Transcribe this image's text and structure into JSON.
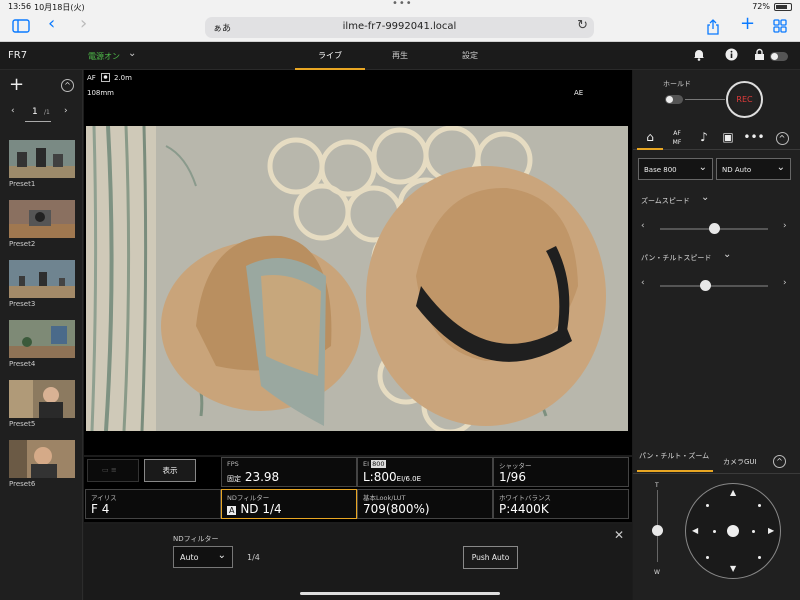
{
  "status": {
    "time": "13:56",
    "date": "10月18日(火)",
    "battery": "72%"
  },
  "browser": {
    "aa": "ぁあ",
    "url": "ilme-fr7-9992041.local"
  },
  "header": {
    "model": "FR7",
    "power": "電源オン",
    "tabs": [
      {
        "label": "ライブ",
        "active": true
      },
      {
        "label": "再生",
        "active": false
      },
      {
        "label": "設定",
        "active": false
      }
    ]
  },
  "presets": {
    "page": "1",
    "total": "/1",
    "items": [
      {
        "label": "Preset1"
      },
      {
        "label": "Preset2"
      },
      {
        "label": "Preset3"
      },
      {
        "label": "Preset4"
      },
      {
        "label": "Preset5"
      },
      {
        "label": "Preset6"
      }
    ]
  },
  "viewer": {
    "af": "AF",
    "distance": "2.0m",
    "focal": "108mm",
    "ae": "AE"
  },
  "info": {
    "display_button": "表示",
    "fps_key": "FPS",
    "fps_prefix": "固定",
    "fps_value": "23.98",
    "ei_key": "EI",
    "ei_badge": "800",
    "ei_value": "L:800",
    "ei_suffix": "EI/6.0E",
    "shutter_key": "シャッター",
    "shutter_value": "1/96",
    "iris_key": "アイリス",
    "iris_value": "F 4",
    "nd_key": "NDフィルター",
    "nd_badge": "A",
    "nd_value": "ND 1/4",
    "lut_key": "基本Look/LUT",
    "lut_value": "709(800%)",
    "wb_key": "ホワイトバランス",
    "wb_value": "P:4400K"
  },
  "nd_panel": {
    "label": "NDフィルター",
    "mode": "Auto",
    "value": "1/4",
    "push_auto": "Push Auto"
  },
  "right": {
    "hold": "ホールド",
    "rec": "REC",
    "base": "Base 800",
    "nd_mode": "ND Auto",
    "zoom_speed": "ズームスピード",
    "pan_tilt_speed": "パン・チルトスピード",
    "section_tab1": "パン・チルト・ズーム",
    "section_tab2": "カメラGUI",
    "zoom_t": "T",
    "zoom_w": "W",
    "zoom_speed_level": 0.5,
    "pan_tilt_speed_level": 0.42
  }
}
